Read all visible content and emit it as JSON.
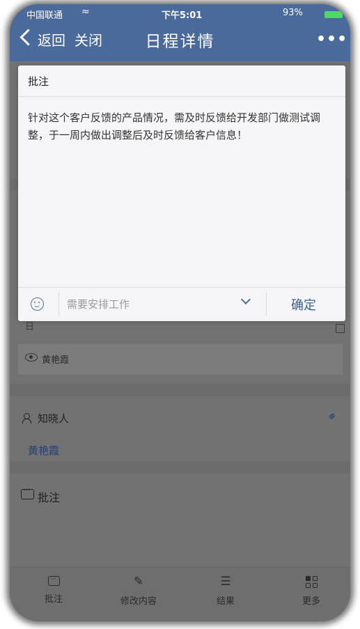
{
  "status_bar": {
    "carrier": "中国联通",
    "wifi": "≈",
    "time": "下午5:01",
    "battery": "93%"
  },
  "nav": {
    "back": "返回",
    "close": "关闭",
    "title": "日程详情",
    "more": "•••"
  },
  "modal": {
    "title": "批注",
    "text": "针对这个客户反馈的产品情况，需及时反馈给开发部门做测试调整，于一周内做出调整后及时反馈给客户信息！",
    "input_placeholder": "需要安排工作",
    "confirm": "确定"
  },
  "page": {
    "partial_row": "日",
    "viewer_name": "黄艳霞",
    "know_label": "知晓人",
    "know_name": "黄艳霞",
    "comment_label": "批注"
  },
  "tabbar": {
    "items": [
      {
        "label": "批注",
        "icon": "comment-icon"
      },
      {
        "label": "修改内容",
        "icon": "edit-icon"
      },
      {
        "label": "结果",
        "icon": "result-icon"
      },
      {
        "label": "更多",
        "icon": "grid-icon"
      }
    ]
  },
  "colors": {
    "header": "#4b6a9c",
    "accent": "#3c5d94",
    "overlay": "#727272"
  }
}
